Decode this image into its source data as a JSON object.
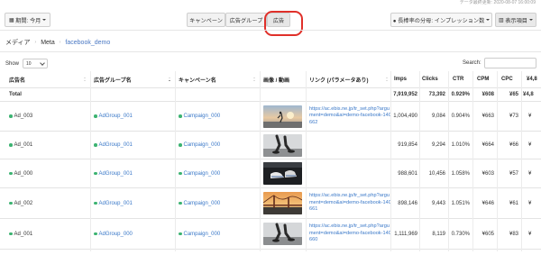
{
  "header": {
    "updated": "データ最終更新: 2020-08-07 16:00:09"
  },
  "toolbar": {
    "period": "期間: 今月",
    "tabs": [
      "キャンペーン",
      "広告グループ",
      "広告"
    ],
    "metric": "● 長棒率の分母: インプレッション数",
    "columns": "表示項目"
  },
  "breadcrumb": {
    "media": "メディア",
    "platform": "Meta",
    "account": "facebook_demo"
  },
  "controls": {
    "show_label": "Show",
    "show_value": "10",
    "search_label": "Search:"
  },
  "table": {
    "headers": [
      "広告名",
      "広告グループ名",
      "キャンペーン名",
      "画像 / 動画",
      "リンク (パラメータあり)",
      "Imps",
      "Clicks",
      "CTR",
      "CPM",
      "CPC",
      "¥4,8"
    ],
    "total": {
      "label": "Total",
      "imps": "7,919,952",
      "clicks": "73,392",
      "ctr": "0.929%",
      "cpm": "¥608",
      "cpc": "¥65",
      "extra": "¥4,8"
    },
    "rows": [
      {
        "ad": "Ad_003",
        "group": "AdGroup_001",
        "campaign": "Campaign_000",
        "thumb": "sunset-runner",
        "link": "https://ac.ebis.ne.jp/tr_set.php?argument=demo&ai=demo-facebook-140662",
        "imps": "1,004,490",
        "clicks": "9,084",
        "ctr": "0.904%",
        "cpm": "¥663",
        "cpc": "¥73",
        "extra": "¥"
      },
      {
        "ad": "Ad_001",
        "group": "AdGroup_001",
        "campaign": "Campaign_000",
        "thumb": "running-legs",
        "link": "",
        "imps": "919,854",
        "clicks": "9,294",
        "ctr": "1.010%",
        "cpm": "¥664",
        "cpc": "¥66",
        "extra": "¥"
      },
      {
        "ad": "Ad_000",
        "group": "AdGroup_001",
        "campaign": "Campaign_000",
        "thumb": "dark-sneakers",
        "link": "",
        "imps": "988,601",
        "clicks": "10,456",
        "ctr": "1.058%",
        "cpm": "¥603",
        "cpc": "¥57",
        "extra": "¥"
      },
      {
        "ad": "Ad_002",
        "group": "AdGroup_001",
        "campaign": "Campaign_000",
        "thumb": "bridge-sunset",
        "link": "https://ac.ebis.ne.jp/tr_set.php?argument=demo&ai=demo-facebook-140661",
        "imps": "898,146",
        "clicks": "9,443",
        "ctr": "1.051%",
        "cpm": "¥646",
        "cpc": "¥61",
        "extra": "¥"
      },
      {
        "ad": "Ad_001",
        "group": "AdGroup_000",
        "campaign": "Campaign_000",
        "thumb": "running-legs",
        "link": "https://ac.ebis.ne.jp/tr_set.php?argument=demo&ai=demo-facebook-140660",
        "imps": "1,111,969",
        "clicks": "8,119",
        "ctr": "0.730%",
        "cpm": "¥605",
        "cpc": "¥83",
        "extra": "¥"
      }
    ]
  }
}
